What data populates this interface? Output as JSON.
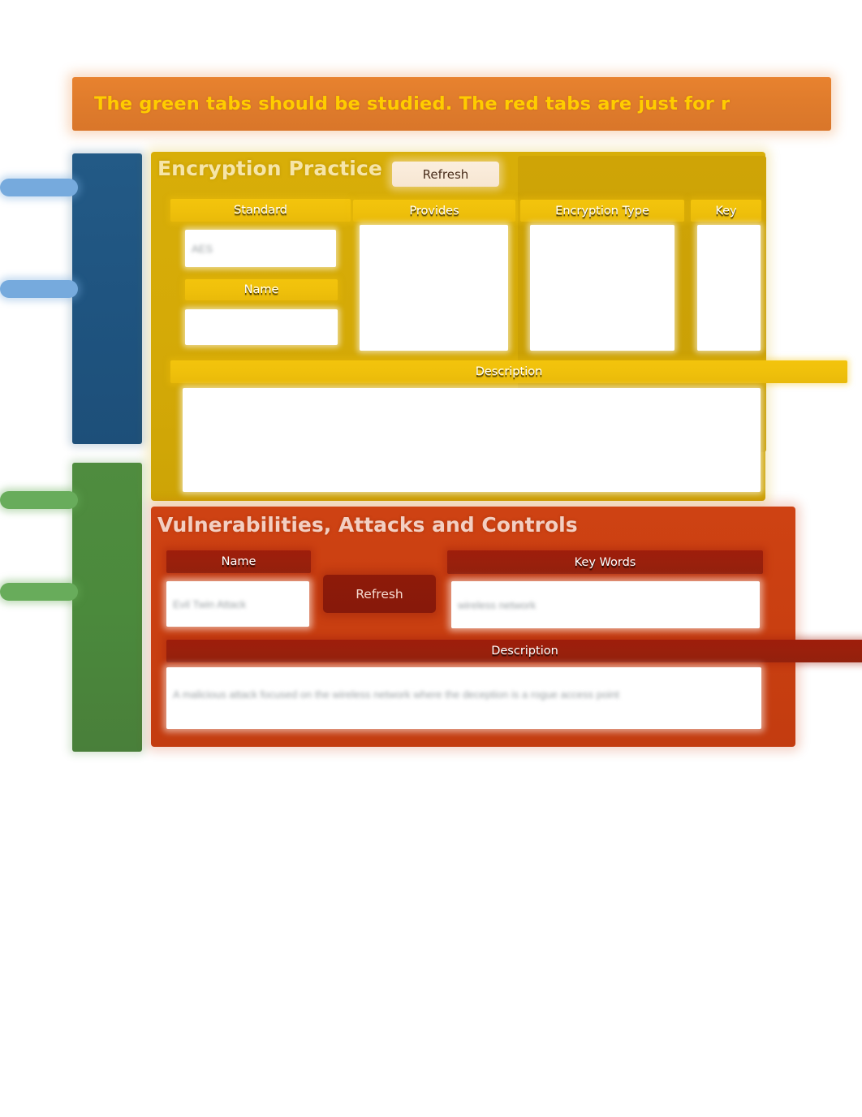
{
  "banner": {
    "text": "The green tabs should be studied. The red tabs are just for r"
  },
  "sidebar": {
    "groups": [
      {
        "name": "blue-tab-group",
        "color": "#1f5480",
        "stubs": [
          "",
          ""
        ]
      },
      {
        "name": "green-tab-group",
        "color": "#4b8a3c",
        "stubs": [
          "",
          ""
        ]
      }
    ]
  },
  "encryption_panel": {
    "title": "Encryption Practice",
    "refresh_label": "Refresh",
    "accent": "#d4a907",
    "header_bar_color": "#efc00b",
    "fields": {
      "standard": {
        "label": "Standard",
        "value": "AES"
      },
      "name": {
        "label": "Name",
        "value": ""
      },
      "provides": {
        "label": "Provides",
        "value": ""
      },
      "encryption_type": {
        "label": "Encryption Type",
        "value": ""
      },
      "key": {
        "label": "Key",
        "value": ""
      },
      "description": {
        "label": "Description",
        "value": ""
      }
    }
  },
  "vulnerabilities_panel": {
    "title": "Vulnerabilities, Attacks and Controls",
    "refresh_label": "Refresh",
    "accent": "#c93f11",
    "header_bar_color": "#99200c",
    "fields": {
      "name": {
        "label": "Name",
        "value": "Evil Twin Attack"
      },
      "key_words": {
        "label": "Key Words",
        "value": "wireless network"
      },
      "description": {
        "label": "Description",
        "value": "A malicious attack focused on the wireless network where the deception is a rogue access point"
      }
    }
  }
}
